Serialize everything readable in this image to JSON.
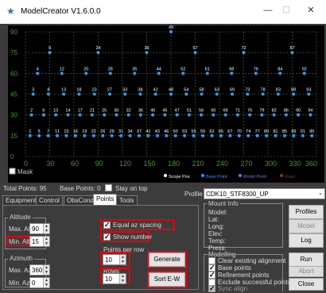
{
  "window": {
    "title": "ModelCreator V1.6.0.0",
    "minimize_glyph": "—",
    "maximize_glyph": "☐",
    "close_glyph": "✕",
    "app_icon": "star-icon"
  },
  "chart": {
    "y_ticks": [
      "90",
      "75",
      "60",
      "45",
      "30",
      "15",
      "0"
    ],
    "x_ticks": [
      "0",
      "30",
      "60",
      "90",
      "120",
      "150",
      "180",
      "210",
      "240",
      "270",
      "300",
      "330",
      "360"
    ],
    "rows": [
      {
        "alt": 15,
        "labels": [
          "1",
          "5",
          "7",
          "11",
          "15",
          "16",
          "19",
          "22",
          "26",
          "29",
          "31",
          "34",
          "37",
          "41",
          "43",
          "46",
          "50",
          "53",
          "55",
          "59",
          "62",
          "65",
          "67",
          "70",
          "74",
          "77",
          "80",
          "81",
          "85",
          "89",
          "91",
          "95"
        ]
      },
      {
        "alt": 30,
        "labels": [
          "2",
          "6",
          "10",
          "14",
          "17",
          "21",
          "25",
          "30",
          "32",
          "36",
          "40",
          "45",
          "47",
          "51",
          "56",
          "60",
          "66",
          "71",
          "76",
          "79",
          "82",
          "86",
          "90",
          "94"
        ]
      },
      {
        "alt": 45,
        "labels": [
          "3",
          "8",
          "13",
          "18",
          "23",
          "27",
          "33",
          "38",
          "42",
          "48",
          "54",
          "58",
          "63",
          "69",
          "73",
          "78",
          "83",
          "88",
          "93"
        ]
      },
      {
        "alt": 60,
        "labels": [
          "4",
          "12",
          "20",
          "28",
          "35",
          "44",
          "52",
          "61",
          "68",
          "76",
          "84",
          "92"
        ]
      },
      {
        "alt": 75,
        "labels": [
          "9",
          "24",
          "39",
          "57",
          "72",
          "87"
        ]
      },
      {
        "alt": 90,
        "labels": [
          "49"
        ]
      }
    ],
    "top_label": "49",
    "legend": [
      {
        "label": "Scope Pos",
        "color": "#ffffff"
      },
      {
        "label": "Base Point",
        "color": "#2f9bff"
      },
      {
        "label": "Model Point",
        "color": "#6a7bd6"
      },
      {
        "label": "Mask",
        "color": "#8a3a1c"
      }
    ],
    "mask_label": "Mask",
    "point_color": "#2f9bff",
    "grid_color": "#4a7a2c",
    "tick_color": "#4a9a2c"
  },
  "status": {
    "total_points": "Total Points: 95",
    "base_points": "Base Points: 0",
    "stay_on_top": "Stay on top",
    "profile_label": "Profile",
    "profile_value": "CDK10_STF8300_UP"
  },
  "tabs": [
    "Equipment",
    "Control",
    "ObsCond",
    "Points",
    "Tools"
  ],
  "active_tab": "Points",
  "altitude": {
    "title": "Altitude",
    "max_label": "Max. Alt",
    "max_value": "90",
    "min_label": "Min. Alt",
    "min_value": "15"
  },
  "azimuth": {
    "title": "Azimuth",
    "max_label": "Max. Az",
    "max_value": "360",
    "min_label": "Min. Az",
    "min_value": "0"
  },
  "options": {
    "equal_az": "Equal az spacing",
    "show_number": "Show number",
    "points_per_row_label": "Points per row",
    "points_per_row_value": "10",
    "generate_button": "Generate",
    "rows_label": "Rows",
    "rows_value": "10",
    "sort_button": "Sort E-W"
  },
  "mount_info": {
    "title": "Mount Info",
    "fields": [
      "Model:",
      "Lat:",
      "Long:",
      "Elev:",
      "Temp:",
      "Press:"
    ]
  },
  "modelling": {
    "title": "Modelling",
    "items": [
      {
        "label": "Clear existing alignment",
        "checked": false,
        "enabled": true
      },
      {
        "label": "Base points",
        "checked": true,
        "enabled": true
      },
      {
        "label": "Refinement points",
        "checked": true,
        "enabled": true
      },
      {
        "label": "Exclude successful points",
        "checked": false,
        "enabled": true
      },
      {
        "label": "Sync align",
        "checked": true,
        "enabled": false
      }
    ]
  },
  "buttons": {
    "profiles": "Profiles",
    "model": "Model",
    "log": "Log",
    "run": "Run",
    "abort": "Abort",
    "close": "Close"
  }
}
